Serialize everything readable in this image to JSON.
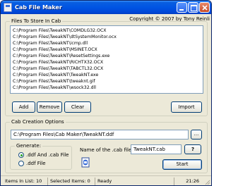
{
  "window": {
    "title": "Cab File Maker",
    "copyright": "Copyright © 2007 by Tony Reinli",
    "controls": {
      "minimize": "minimize",
      "maximize": "maximize",
      "close": "close"
    }
  },
  "files_group": {
    "label": "Files To Store In Cab",
    "files": [
      "C:\\Program Files\\TweakNT\\COMDLG32.OCX",
      "C:\\Program Files\\TweakNT\\dtSystemMonitor.ocx",
      "C:\\Program Files\\TweakNT\\icmp.dll",
      "C:\\Program Files\\TweakNT\\MSINET.OCX",
      "C:\\Program Files\\TweakNT\\ResetSettings.exe",
      "C:\\Program Files\\TweakNT\\RICHTX32.OCX",
      "C:\\Program Files\\TweakNT\\TABCTL32.OCX",
      "C:\\Program Files\\TweakNT\\TweakNT.exe",
      "C:\\Program Files\\TweakNT\\tweaknt.gif",
      "C:\\Program Files\\TweakNT\\wsock32.dll"
    ],
    "add_label": "Add",
    "remove_label": "Remove",
    "clear_label": "Clear",
    "import_label": "Import"
  },
  "options_group": {
    "label": "Cab Creation Options",
    "path_value": "C:\\Program Files\\Cab Maker\\TweakNT.ddf",
    "browse_label": "...",
    "generate_group": {
      "label": "Generate:",
      "options": [
        {
          "label": ".ddf And .cab File",
          "checked": true
        },
        {
          "label": ".ddf File",
          "checked": false
        }
      ]
    },
    "cab_name_label": "Name of the .cab file:",
    "cab_name_value": "TweakNT.cab",
    "help_label": "?",
    "start_label": "Start"
  },
  "statusbar": {
    "items_in_list": "Items In List: 10",
    "selected_items": "Selected Items: 0",
    "status": "Ready",
    "clock": "21:26"
  },
  "icons": [
    "app-icon",
    "cab-icon",
    "size-grip-icon"
  ],
  "colors": {
    "titlebar": "#0054e3",
    "window_bg": "#ece9d8",
    "border": "#7f9db9"
  }
}
